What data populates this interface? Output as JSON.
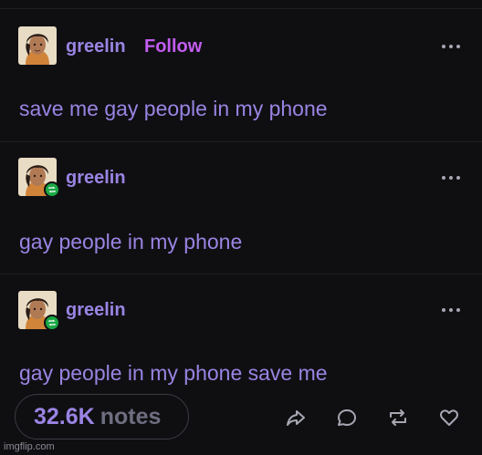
{
  "posts": [
    {
      "username": "greelin",
      "follow_label": "Follow",
      "text": "save me gay people in my phone",
      "reblogged": false
    },
    {
      "username": "greelin",
      "text": "gay people in my phone",
      "reblogged": true
    },
    {
      "username": "greelin",
      "text": "gay people in my phone save me",
      "reblogged": true
    }
  ],
  "footer": {
    "notes_count": "32.6K",
    "notes_label": "notes",
    "actions": [
      "share-icon",
      "reply-icon",
      "reblog-icon",
      "like-icon"
    ]
  },
  "watermark": "imgflip.com",
  "colors": {
    "background": "#0f0f12",
    "text": "#9a84e3",
    "follow": "#c35cf0",
    "reblog_badge": "#1aa845",
    "icon": "#a7a7b3"
  }
}
